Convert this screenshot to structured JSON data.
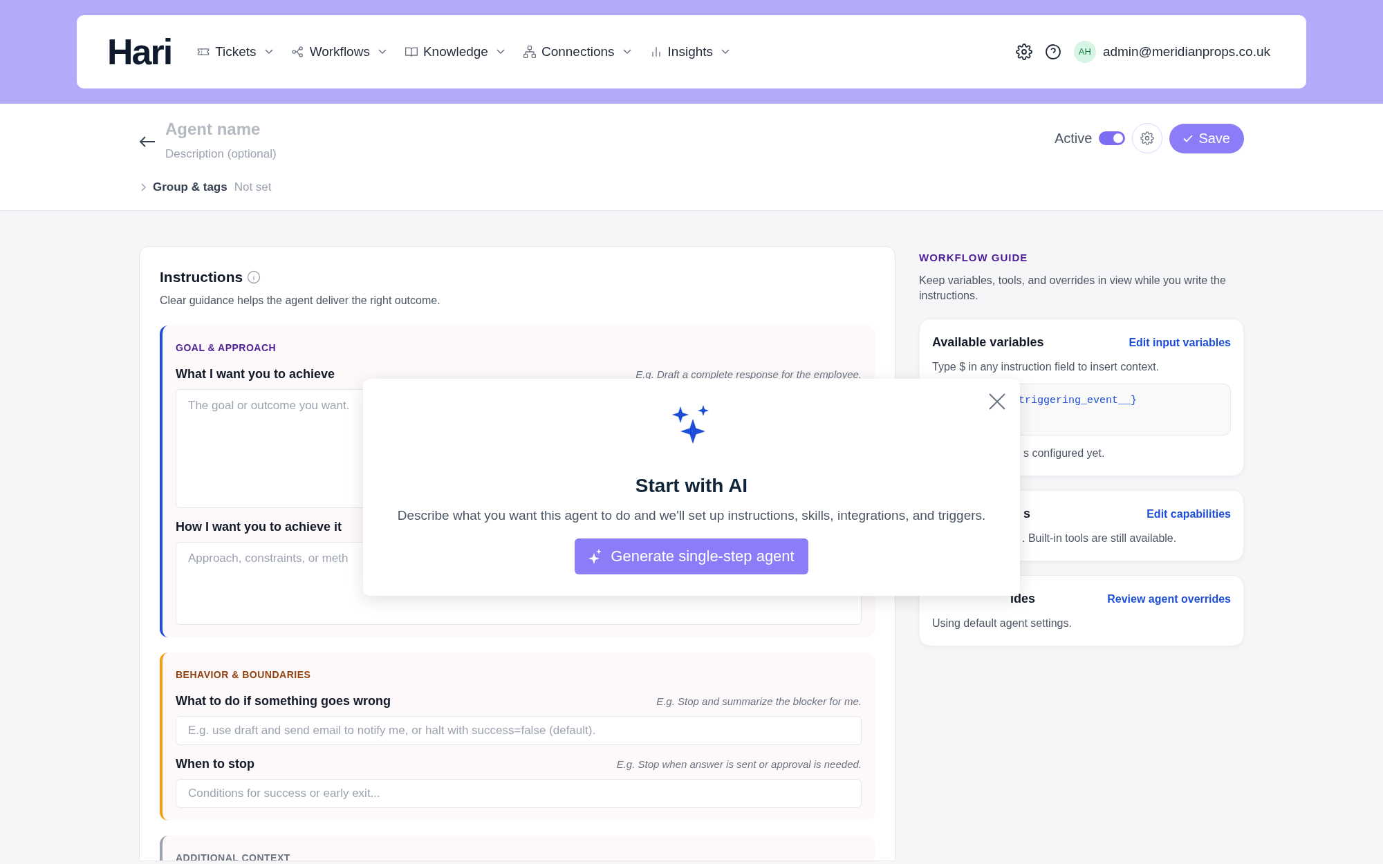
{
  "brand": "Hari",
  "nav": [
    {
      "label": "Tickets"
    },
    {
      "label": "Workflows"
    },
    {
      "label": "Knowledge"
    },
    {
      "label": "Connections"
    },
    {
      "label": "Insights"
    }
  ],
  "user": {
    "initials": "AH",
    "email": "admin@meridianprops.co.uk"
  },
  "agent": {
    "name_placeholder": "Agent name",
    "description_placeholder": "Description (optional)",
    "active_label": "Active",
    "active": true,
    "save_label": "Save",
    "group_label": "Group & tags",
    "group_value": "Not set"
  },
  "instructions": {
    "title": "Instructions",
    "subtitle": "Clear guidance helps the agent deliver the right outcome.",
    "sections": [
      {
        "title": "GOAL & APPROACH",
        "color": "#1d4ed8",
        "fields": [
          {
            "kind": "textarea",
            "label": "What I want you to achieve",
            "example": "E.g. Draft a complete response for the employee.",
            "placeholder": "The goal or outcome you want."
          },
          {
            "kind": "textarea",
            "label": "How I want you to achieve it",
            "placeholder": "Approach, constraints, or meth"
          }
        ]
      },
      {
        "title": "BEHAVIOR & BOUNDARIES",
        "color": "#f59e0b",
        "fields": [
          {
            "kind": "input",
            "label": "What to do if something goes wrong",
            "example": "E.g. Stop and summarize the blocker for me.",
            "placeholder": "E.g. use draft and send email to notify me, or halt with success=false (default)."
          },
          {
            "kind": "input",
            "label": "When to stop",
            "example": "E.g. Stop when answer is sent or approval is needed.",
            "placeholder": "Conditions for success or early exit..."
          }
        ]
      },
      {
        "title": "ADDITIONAL CONTEXT",
        "color": "#9ca3af"
      }
    ]
  },
  "guide": {
    "title": "WORKFLOW GUIDE",
    "description": "Keep variables, tools, and overrides in view while you write the instructions.",
    "cards": [
      {
        "title": "Available variables",
        "link": "Edit input variables",
        "text": "Type $ in any instruction field to insert context.",
        "code": "triggering_event__}",
        "note": "s configured yet."
      },
      {
        "title": "s",
        "link": "Edit capabilities",
        "text": ". Built-in tools are still available."
      },
      {
        "title": "ides",
        "link": "Review agent overrides",
        "text": "Using default agent settings."
      }
    ]
  },
  "modal": {
    "title": "Start with AI",
    "description": "Describe what you want this agent to do and we'll set up instructions, skills, integrations, and triggers.",
    "button": "Generate single-step agent"
  }
}
